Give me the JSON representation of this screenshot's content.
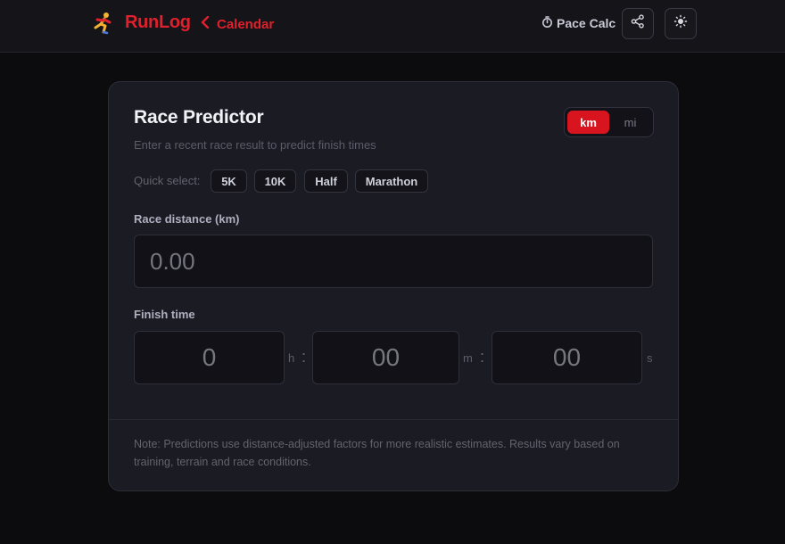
{
  "header": {
    "logo_icon": "runner-emoji-icon",
    "brand": "RunLog",
    "back_label": "Calendar",
    "pace_icon": "stopwatch-icon",
    "pace_label": "Pace Calc",
    "share_icon": "share-icon",
    "theme_icon": "sun-icon"
  },
  "card": {
    "title": "Race Predictor",
    "subtitle": "Enter a recent race result to predict finish times",
    "unit_toggle": {
      "options": [
        "km",
        "mi"
      ],
      "selected": "km"
    },
    "quick_select": {
      "label": "Quick select:",
      "options": [
        "5K",
        "10K",
        "Half",
        "Marathon"
      ]
    },
    "distance": {
      "label": "Race distance (km)",
      "placeholder": "0.00"
    },
    "finish_time": {
      "label": "Finish time",
      "hours_placeholder": "0",
      "minutes_placeholder": "00",
      "seconds_placeholder": "00",
      "hours_unit": "h",
      "minutes_unit": "m",
      "seconds_unit": "s",
      "separator": ":"
    },
    "note": "Note: Predictions use distance-adjusted factors for more realistic estimates. Results vary based on training, terrain and race conditions."
  },
  "colors": {
    "accent": "#e0202c",
    "background": "#0c0c0e",
    "card": "#1b1b23"
  }
}
